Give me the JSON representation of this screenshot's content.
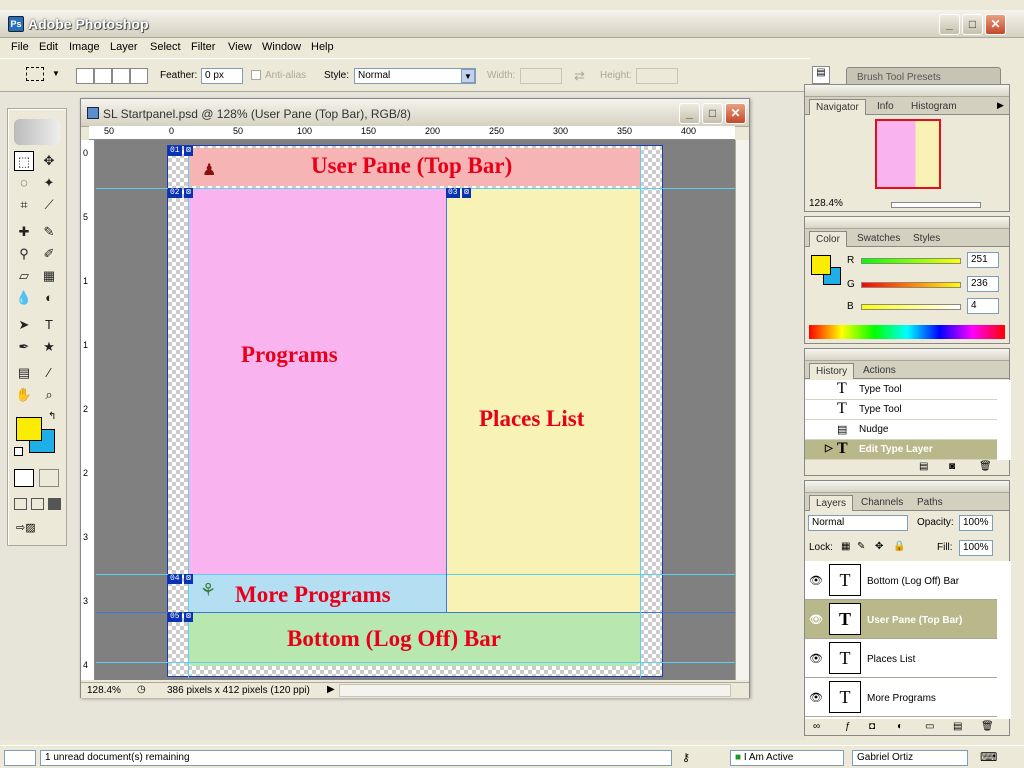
{
  "app": {
    "title": "Adobe Photoshop",
    "icon": "photoshop-icon"
  },
  "menu": [
    "File",
    "Edit",
    "Image",
    "Layer",
    "Select",
    "Filter",
    "View",
    "Window",
    "Help"
  ],
  "options": {
    "feather_label": "Feather:",
    "feather_value": "0 px",
    "antialias_label": "Anti-alias",
    "style_label": "Style:",
    "style_value": "Normal",
    "width_label": "Width:",
    "height_label": "Height:",
    "palette_well": "Brush Tool Presets"
  },
  "document": {
    "title": "SL Startpanel.psd @ 128% (User Pane (Top Bar), RGB/8)",
    "zoom": "128.4%",
    "info": "386 pixels x 412 pixels (120 ppi)",
    "ruler_h": [
      "50",
      "0",
      "50",
      "100",
      "150",
      "200",
      "250",
      "300",
      "350",
      "400"
    ],
    "ruler_v": [
      "0",
      "5",
      "1",
      "1",
      "2",
      "2",
      "3",
      "3",
      "4"
    ]
  },
  "canvas": {
    "panes": {
      "top": "User Pane (Top Bar)",
      "programs": "Programs",
      "places": "Places List",
      "more": "More Programs",
      "bottom": "Bottom (Log Off) Bar"
    },
    "slices": [
      "01",
      "02",
      "03",
      "04",
      "05"
    ],
    "colors": {
      "top": "#f7b4b4",
      "programs": "#f9b4f0",
      "places": "#f8f2b4",
      "more": "#b4dff2",
      "bottom": "#b8e8b0"
    }
  },
  "navigator": {
    "tabs": [
      "Navigator",
      "Info",
      "Histogram"
    ],
    "zoom": "128.4%"
  },
  "color": {
    "tabs": [
      "Color",
      "Swatches",
      "Styles"
    ],
    "r_label": "R",
    "g_label": "G",
    "b_label": "B",
    "r": "251",
    "g": "236",
    "b": "4",
    "fg": "#fbec04",
    "bg": "#1eaee8"
  },
  "history": {
    "tabs": [
      "History",
      "Actions"
    ],
    "items": [
      "Type Tool",
      "Type Tool",
      "Nudge",
      "Edit Type Layer"
    ]
  },
  "layers": {
    "tabs": [
      "Layers",
      "Channels",
      "Paths"
    ],
    "blend": "Normal",
    "opacity_label": "Opacity:",
    "opacity": "100%",
    "lock_label": "Lock:",
    "fill_label": "Fill:",
    "fill": "100%",
    "items": [
      "Bottom (Log Off) Bar",
      "User Pane (Top Bar)",
      "Places List",
      "More Programs"
    ]
  },
  "taskbar": {
    "status": "1 unread document(s) remaining",
    "presence": "I Am Active",
    "user": "Gabriel Ortiz"
  }
}
